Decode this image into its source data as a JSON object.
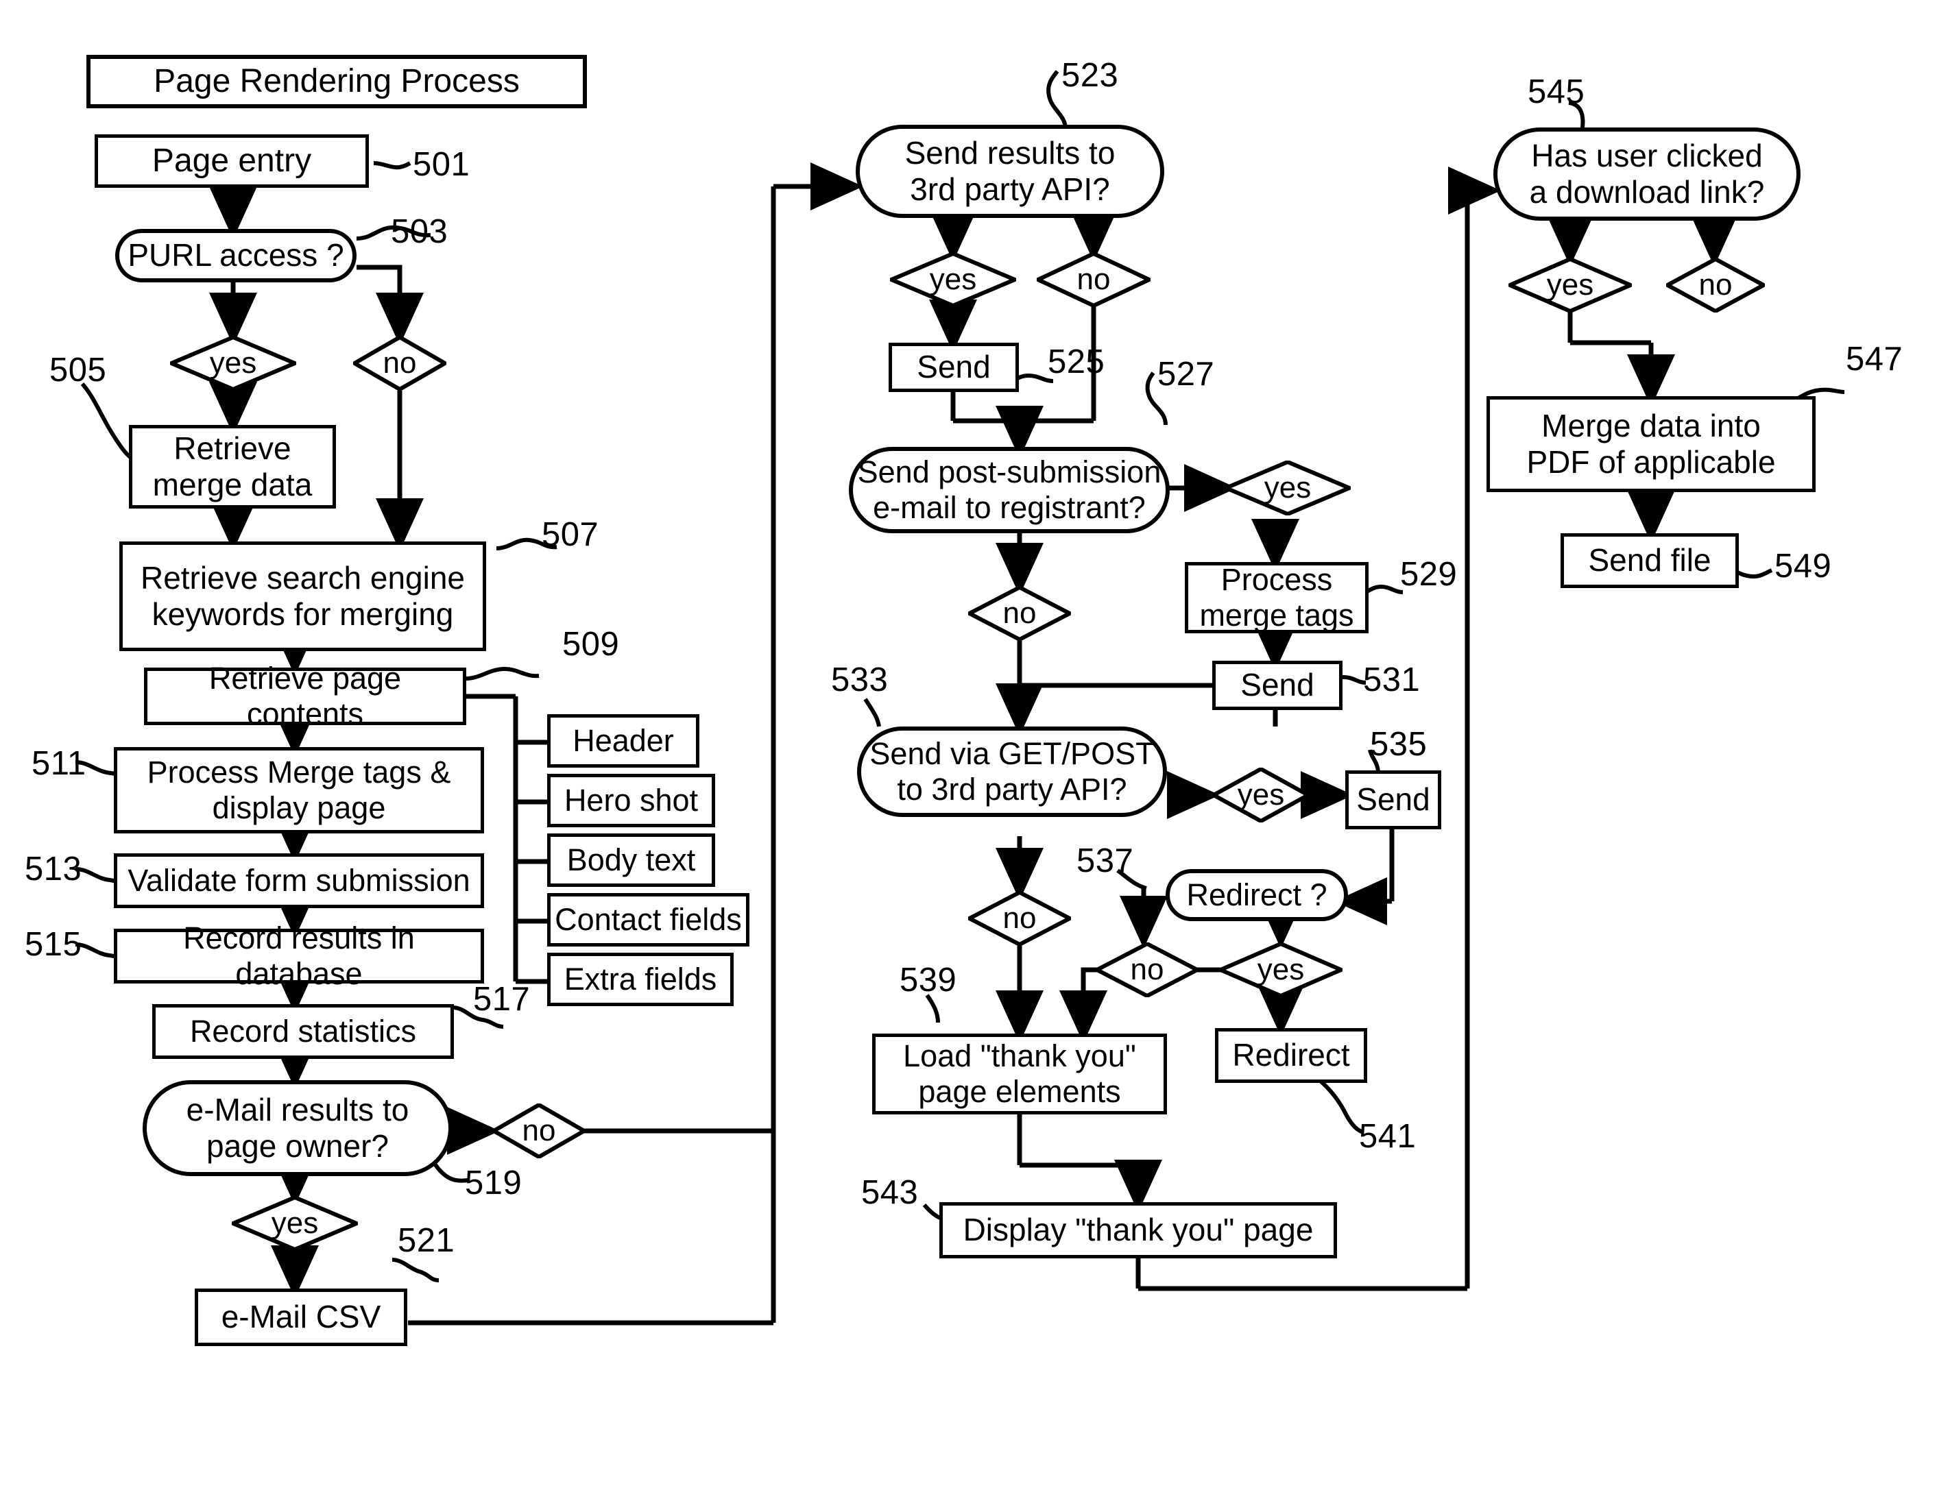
{
  "diagram": {
    "title": "Page Rendering Process",
    "figure_kind": "flowchart"
  },
  "nodes": {
    "title_box": {
      "label": "Page Rendering Process",
      "shape": "rect"
    },
    "n501": {
      "label": "Page entry",
      "ref": "501",
      "shape": "rect"
    },
    "n503": {
      "label": "PURL access ?",
      "ref": "503",
      "shape": "pill"
    },
    "n505": {
      "label": "Retrieve\nmerge data",
      "ref": "505",
      "shape": "rect"
    },
    "n507": {
      "label": "Retrieve search engine\nkeywords for merging",
      "ref": "507",
      "shape": "rect"
    },
    "n509": {
      "label": "Retrieve page contents",
      "ref": "509",
      "shape": "rect"
    },
    "n511": {
      "label": "Process Merge tags &\ndisplay page",
      "ref": "511",
      "shape": "rect"
    },
    "n513": {
      "label": "Validate form submission",
      "ref": "513",
      "shape": "rect"
    },
    "n515": {
      "label": "Record results in database",
      "ref": "515",
      "shape": "rect"
    },
    "n517": {
      "label": "Record statistics",
      "ref": "517",
      "shape": "rect"
    },
    "n519": {
      "label": "e-Mail results to\npage owner?",
      "ref": "519",
      "shape": "pill"
    },
    "n521": {
      "label": "e-Mail CSV",
      "ref": "521",
      "shape": "rect"
    },
    "n523": {
      "label": "Send results to\n3rd party API?",
      "ref": "523",
      "shape": "pill"
    },
    "n525": {
      "label": "Send",
      "ref": "525",
      "shape": "rect"
    },
    "n527": {
      "label": "Send post-submission\ne-mail to registrant?",
      "ref": "527",
      "shape": "pill"
    },
    "n529": {
      "label": "Process\nmerge tags",
      "ref": "529",
      "shape": "rect"
    },
    "n531": {
      "label": "Send",
      "ref": "531",
      "shape": "rect"
    },
    "n533": {
      "label": "Send via GET/POST\nto 3rd party API?",
      "ref": "533",
      "shape": "pill"
    },
    "n535": {
      "label": "Send",
      "ref": "535",
      "shape": "rect"
    },
    "n537": {
      "label": "Redirect ?",
      "ref": "537",
      "shape": "pill"
    },
    "n539": {
      "label": "Load \"thank you\"\npage elements",
      "ref": "539",
      "shape": "rect"
    },
    "n541": {
      "label": "Redirect",
      "ref": "541",
      "shape": "rect"
    },
    "n543": {
      "label": "Display \"thank you\" page",
      "ref": "543",
      "shape": "rect"
    },
    "n545": {
      "label": "Has user clicked\na download link?",
      "ref": "545",
      "shape": "pill"
    },
    "n547": {
      "label": "Merge data into\nPDF of applicable",
      "ref": "547",
      "shape": "rect"
    },
    "n549": {
      "label": "Send file",
      "ref": "549",
      "shape": "rect"
    }
  },
  "content_items": [
    {
      "label": "Header"
    },
    {
      "label": "Hero shot"
    },
    {
      "label": "Body text"
    },
    {
      "label": "Contact fields"
    },
    {
      "label": "Extra fields"
    }
  ],
  "decisions": {
    "d503_yes": "yes",
    "d503_no": "no",
    "d519_no": "no",
    "d519_yes": "yes",
    "d523_yes": "yes",
    "d523_no": "no",
    "d527_yes": "yes",
    "d527_no": "no",
    "d533_yes": "yes",
    "d533_no": "no",
    "d537_no": "no",
    "d537_yes": "yes",
    "d545_yes": "yes",
    "d545_no": "no"
  },
  "colors": {
    "ink": "#000000",
    "paper": "#ffffff"
  }
}
